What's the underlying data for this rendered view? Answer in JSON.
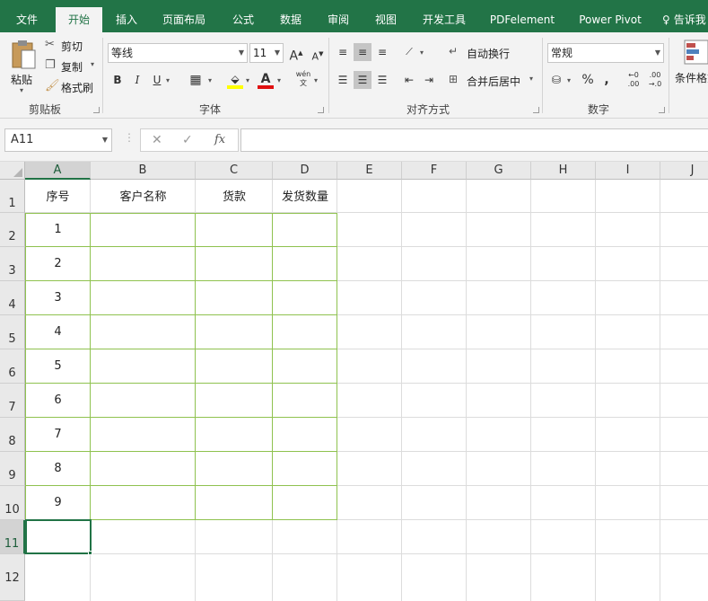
{
  "menu": {
    "tabs": [
      {
        "label": "文件"
      },
      {
        "label": "开始"
      },
      {
        "label": "插入"
      },
      {
        "label": "页面布局"
      },
      {
        "label": "公式"
      },
      {
        "label": "数据"
      },
      {
        "label": "审阅"
      },
      {
        "label": "视图"
      },
      {
        "label": "开发工具"
      },
      {
        "label": "PDFelement"
      },
      {
        "label": "Power Pivot"
      }
    ],
    "active_tab": "开始",
    "tell_me": "告诉我"
  },
  "ribbon": {
    "clipboard": {
      "group": "剪贴板",
      "paste": "粘贴",
      "cut": "剪切",
      "copy": "复制",
      "format_painter": "格式刷"
    },
    "font": {
      "group": "字体",
      "font_name": "等线",
      "font_size": "11",
      "bold": "B",
      "italic": "I",
      "underline": "U",
      "grow": "A",
      "shrink": "A",
      "phonetic": "wén"
    },
    "alignment": {
      "group": "对齐方式",
      "wrap_text": "自动换行",
      "merge_center": "合并后居中"
    },
    "number": {
      "group": "数字",
      "format": "常规",
      "percent": "%",
      "comma": ","
    },
    "styles": {
      "conditional": "条件格式"
    },
    "colors": {
      "accent": "#217346",
      "highlight": "#ffff00",
      "font_color": "#e01010"
    }
  },
  "formula_bar": {
    "name_box": "A11",
    "fx": "fx",
    "content": ""
  },
  "sheet": {
    "columns": [
      "A",
      "B",
      "C",
      "D",
      "E",
      "F",
      "G",
      "H",
      "I",
      "J"
    ],
    "rows": [
      "1",
      "2",
      "3",
      "4",
      "5",
      "6",
      "7",
      "8",
      "9",
      "10",
      "11",
      "12"
    ],
    "headers": [
      "序号",
      "客户名称",
      "货款",
      "发货数量"
    ],
    "serials": [
      "1",
      "2",
      "3",
      "4",
      "5",
      "6",
      "7",
      "8",
      "9"
    ],
    "active_cell": "A11"
  }
}
